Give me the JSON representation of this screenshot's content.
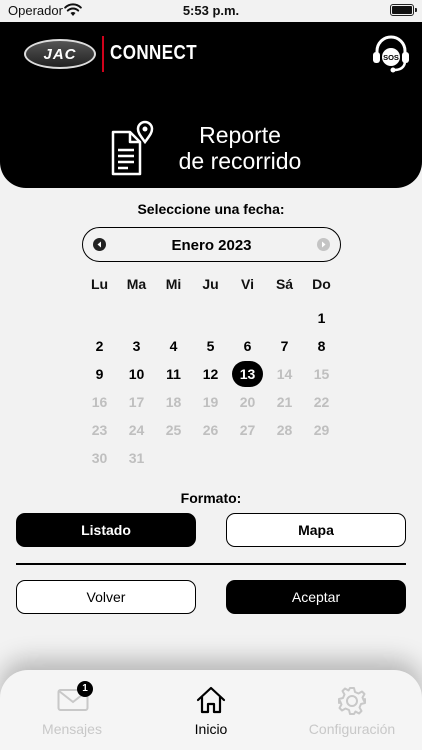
{
  "status_bar": {
    "carrier": "Operador",
    "time": "5:53 p.m."
  },
  "header": {
    "logo_text": "JAC",
    "brand_suffix": "CONNECT",
    "sos_label": "SOS"
  },
  "banner": {
    "title_line1": "Reporte",
    "title_line2": "de recorrido"
  },
  "calendar": {
    "prompt": "Seleccione una fecha:",
    "month_label": "Enero 2023",
    "weekdays": [
      "Lu",
      "Ma",
      "Mi",
      "Ju",
      "Vi",
      "Sá",
      "Do"
    ],
    "weeks": [
      [
        {
          "d": "",
          "s": ""
        },
        {
          "d": "",
          "s": ""
        },
        {
          "d": "",
          "s": ""
        },
        {
          "d": "",
          "s": ""
        },
        {
          "d": "",
          "s": ""
        },
        {
          "d": "",
          "s": ""
        },
        {
          "d": "1",
          "s": "active"
        }
      ],
      [
        {
          "d": "2",
          "s": "active"
        },
        {
          "d": "3",
          "s": "active"
        },
        {
          "d": "4",
          "s": "active"
        },
        {
          "d": "5",
          "s": "active"
        },
        {
          "d": "6",
          "s": "active"
        },
        {
          "d": "7",
          "s": "active"
        },
        {
          "d": "8",
          "s": "active"
        }
      ],
      [
        {
          "d": "9",
          "s": "active"
        },
        {
          "d": "10",
          "s": "active"
        },
        {
          "d": "11",
          "s": "active"
        },
        {
          "d": "12",
          "s": "active"
        },
        {
          "d": "13",
          "s": "selected"
        },
        {
          "d": "14",
          "s": "inactive"
        },
        {
          "d": "15",
          "s": "inactive"
        }
      ],
      [
        {
          "d": "16",
          "s": "inactive"
        },
        {
          "d": "17",
          "s": "inactive"
        },
        {
          "d": "18",
          "s": "inactive"
        },
        {
          "d": "19",
          "s": "inactive"
        },
        {
          "d": "20",
          "s": "inactive"
        },
        {
          "d": "21",
          "s": "inactive"
        },
        {
          "d": "22",
          "s": "inactive"
        }
      ],
      [
        {
          "d": "23",
          "s": "inactive"
        },
        {
          "d": "24",
          "s": "inactive"
        },
        {
          "d": "25",
          "s": "inactive"
        },
        {
          "d": "26",
          "s": "inactive"
        },
        {
          "d": "27",
          "s": "inactive"
        },
        {
          "d": "28",
          "s": "inactive"
        },
        {
          "d": "29",
          "s": "inactive"
        }
      ],
      [
        {
          "d": "30",
          "s": "inactive"
        },
        {
          "d": "31",
          "s": "inactive"
        },
        {
          "d": "",
          "s": ""
        },
        {
          "d": "",
          "s": ""
        },
        {
          "d": "",
          "s": ""
        },
        {
          "d": "",
          "s": ""
        },
        {
          "d": "",
          "s": ""
        }
      ]
    ]
  },
  "format": {
    "label": "Formato:",
    "option_list": "Listado",
    "option_map": "Mapa",
    "selected": "Listado"
  },
  "actions": {
    "back": "Volver",
    "accept": "Aceptar"
  },
  "tabbar": {
    "messages": "Mensajes",
    "messages_badge": "1",
    "home": "Inicio",
    "settings": "Configuración",
    "active": "Inicio"
  },
  "icons": {
    "wifi": "wifi-icon",
    "battery": "battery-icon",
    "sos": "headset-sos-icon",
    "report": "document-location-icon",
    "prev": "chevron-left-icon",
    "next": "chevron-right-icon",
    "messages": "envelope-icon",
    "home": "home-icon",
    "settings": "gear-icon"
  },
  "colors": {
    "primary": "#000000",
    "background": "#f2f2f2",
    "accent_red": "#d0021b",
    "disabled": "#bfbfbf"
  }
}
